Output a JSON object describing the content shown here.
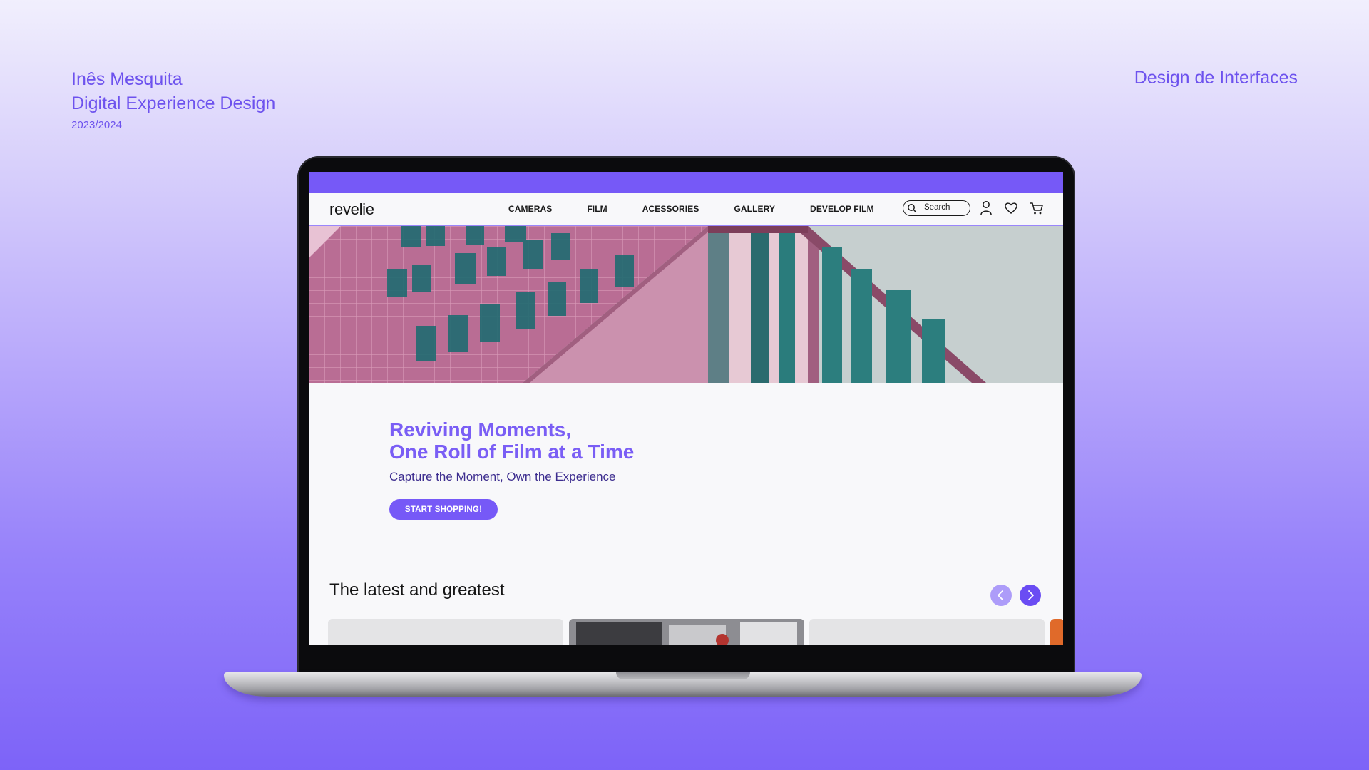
{
  "presentation": {
    "author": "Inês Mesquita",
    "course": "Digital Experience Design",
    "year": "2023/2024",
    "subject": "Design de Interfaces"
  },
  "site": {
    "logo": "revelie",
    "nav": [
      "CAMERAS",
      "FILM",
      "ACESSORIES",
      "GALLERY",
      "DEVELOP FILM"
    ],
    "search_placeholder": "Search",
    "icons": [
      "search-icon",
      "user-icon",
      "heart-icon",
      "cart-icon"
    ],
    "hero": {
      "headline_1": "Reviving Moments,",
      "headline_2": "One Roll of Film at a Time",
      "subheadline": "Capture the Moment, Own the Experience",
      "cta": "START SHOPPING!"
    },
    "latest": {
      "title": "The latest and greatest"
    },
    "colors": {
      "accent": "#7659f7",
      "headline": "#7a5ef5",
      "subheadline": "#3d2d8f"
    }
  }
}
